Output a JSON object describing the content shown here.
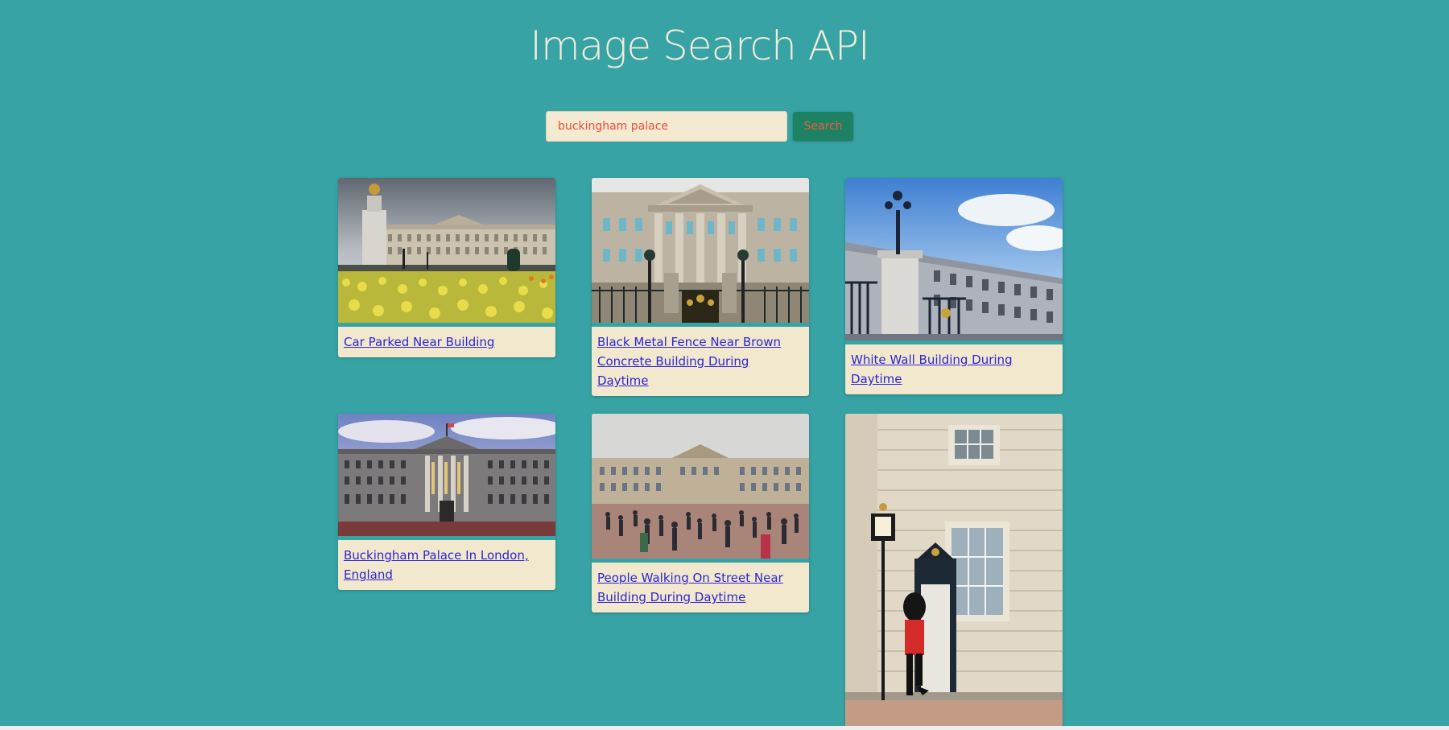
{
  "header": {
    "title": "Image Search API"
  },
  "search": {
    "value": "buckingham palace",
    "button_label": "Search"
  },
  "results": [
    {
      "caption": "Car Parked Near Building"
    },
    {
      "caption": "Black Metal Fence Near Brown Concrete Building During Daytime"
    },
    {
      "caption": "White Wall Building During Daytime"
    },
    {
      "caption": "Buckingham Palace In London, England"
    },
    {
      "caption": "People Walking On Street Near Building During Daytime"
    },
    {
      "caption": ""
    }
  ],
  "colors": {
    "background": "#37a3a5",
    "title": "#f3ecd9",
    "input_bg": "#f3ead1",
    "input_text": "#ea4e36",
    "button_bg": "#1c8263",
    "button_text": "#ef5d3e",
    "card_bg": "#f1e8ce",
    "link": "#2d25d6"
  }
}
